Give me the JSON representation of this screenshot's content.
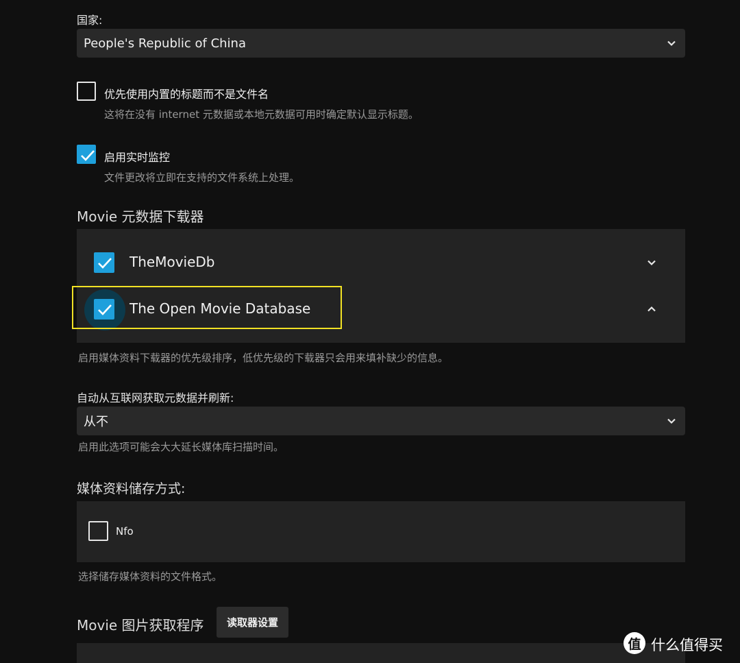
{
  "country": {
    "label": "国家:",
    "value": "People's Republic of China"
  },
  "options": {
    "prefer_embedded": {
      "title": "优先使用内置的标题而不是文件名",
      "desc": "这将在没有 internet 元数据或本地元数据可用时确定默认显示标题。",
      "checked": false
    },
    "realtime_monitor": {
      "title": "启用实时监控",
      "desc": "文件更改将立即在支持的文件系统上处理。",
      "checked": true
    }
  },
  "metadata_downloaders": {
    "heading": "Movie 元数据下载器",
    "items": [
      {
        "label": "TheMovieDb",
        "checked": true,
        "expanded": false
      },
      {
        "label": "The Open Movie Database",
        "checked": true,
        "expanded": true
      }
    ],
    "help": "启用媒体资料下载器的优先级排序，低优先级的下载器只会用来填补缺少的信息。"
  },
  "auto_refresh": {
    "label": "自动从互联网获取元数据并刷新:",
    "value": "从不",
    "help": "启用此选项可能会大大延长媒体库扫描时间。"
  },
  "metadata_savers": {
    "heading": "媒体资料储存方式:",
    "items": [
      {
        "label": "Nfo",
        "checked": false
      }
    ],
    "help": "选择储存媒体资料的文件格式。"
  },
  "image_fetchers": {
    "heading": "Movie 图片获取程序",
    "settings_button": "读取器设置"
  },
  "watermark": {
    "text": "什么值得买",
    "logo_char": "值"
  },
  "colors": {
    "background": "#101010",
    "accent": "#1ea0dc",
    "highlight_box": "#f2e224"
  }
}
